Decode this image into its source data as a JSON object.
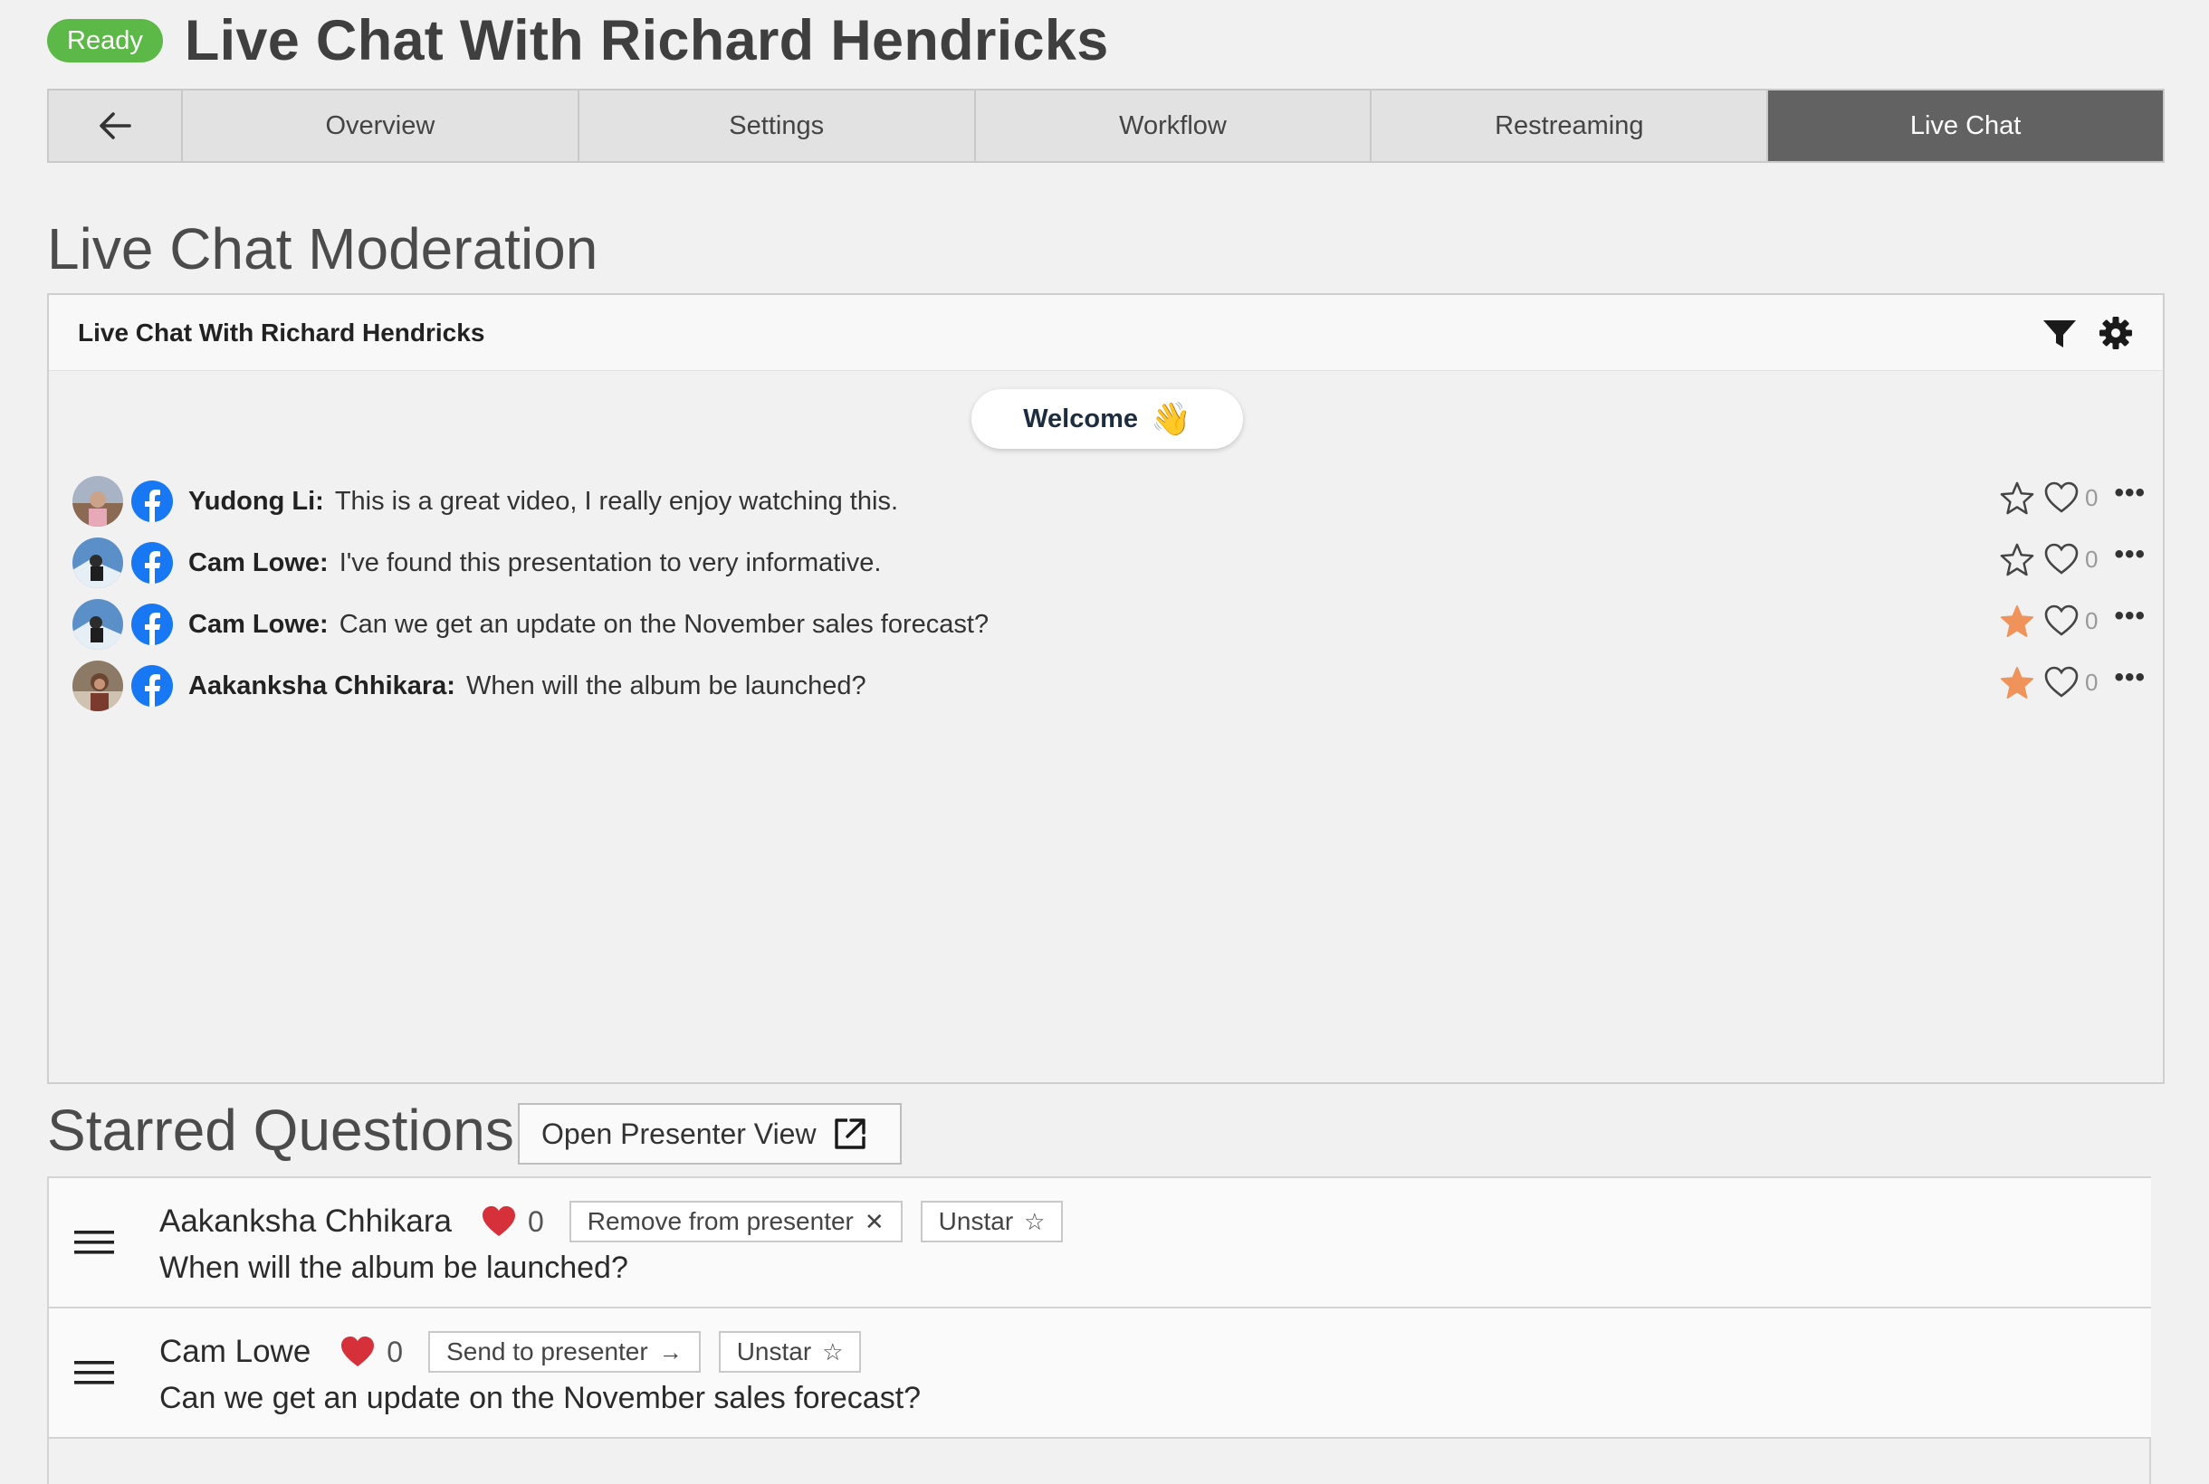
{
  "header": {
    "status": "Ready",
    "title": "Live Chat With Richard Hendricks"
  },
  "tabs": {
    "back_icon": "arrow-left-icon",
    "items": [
      {
        "label": "Overview",
        "active": false
      },
      {
        "label": "Settings",
        "active": false
      },
      {
        "label": "Workflow",
        "active": false
      },
      {
        "label": "Restreaming",
        "active": false
      },
      {
        "label": "Live Chat",
        "active": true
      }
    ]
  },
  "moderation": {
    "section_title": "Live Chat Moderation",
    "panel_title": "Live Chat With Richard Hendricks",
    "icons": [
      "filter-icon",
      "gear-icon"
    ],
    "welcome": {
      "label": "Welcome",
      "emoji": "👋"
    },
    "messages": [
      {
        "author": "Yudong Li:",
        "text": "This is a great video, I really enjoy watching this.",
        "starred": false,
        "likes": "0"
      },
      {
        "author": "Cam Lowe:",
        "text": "I've found this presentation to very informative.",
        "starred": false,
        "likes": "0"
      },
      {
        "author": "Cam Lowe:",
        "text": "Can we get an update on the November sales forecast?",
        "starred": true,
        "likes": "0"
      },
      {
        "author": "Aakanksha Chhikara:",
        "text": "When will the album be launched?",
        "starred": true,
        "likes": "0"
      }
    ],
    "more_label": "•••"
  },
  "starred": {
    "section_title": "Starred Questions",
    "open_presenter_label": "Open Presenter View",
    "items": [
      {
        "name": "Aakanksha Chhikara",
        "likes": "0",
        "action_label": "Remove from presenter",
        "action_glyph": "✕",
        "unstar_label": "Unstar",
        "unstar_glyph": "☆",
        "text": "When will the album be launched?"
      },
      {
        "name": "Cam Lowe",
        "likes": "0",
        "action_label": "Send to presenter",
        "action_glyph": "→",
        "unstar_label": "Unstar",
        "unstar_glyph": "☆",
        "text": "Can we get an update on the November sales forecast?"
      }
    ]
  },
  "colors": {
    "ready": "#5cb948",
    "active_tab": "#626262",
    "star_on": "#f0935a",
    "heart": "#d6313a",
    "facebook": "#1877f2"
  }
}
